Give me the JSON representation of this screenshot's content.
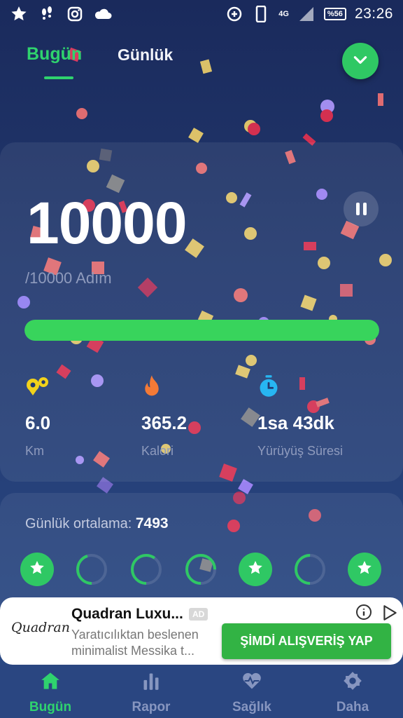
{
  "status_bar": {
    "time": "23:26",
    "network": "4G",
    "battery": "%56",
    "icons": [
      "star-icon",
      "footprints-icon",
      "instagram-icon",
      "cloud-icon",
      "data-saver-icon",
      "phone-icon",
      "signal-icon",
      "battery-icon"
    ]
  },
  "header": {
    "tab_today": "Bugün",
    "tab_daily": "Günlük"
  },
  "steps": {
    "count": "10000",
    "goal": "/10000 Adım",
    "progress_fraction": 1.0
  },
  "stats": [
    {
      "icon": "distance-icon",
      "value": "6.0",
      "label": "Km",
      "color": "#f2d21b"
    },
    {
      "icon": "flame-icon",
      "value": "365.2",
      "label": "Kalori",
      "color": "#f47a36"
    },
    {
      "icon": "stopwatch-icon",
      "value": "1sa 43dk",
      "label": "Yürüyüş Süresi",
      "color": "#27b6f2"
    }
  ],
  "daily_average": {
    "label": "Günlük ortalama:",
    "value": "7493"
  },
  "week_days": [
    {
      "state": "done"
    },
    {
      "state": "partial",
      "fraction": 0.45
    },
    {
      "state": "partial",
      "fraction": 0.6
    },
    {
      "state": "partial",
      "fraction": 0.75
    },
    {
      "state": "done"
    },
    {
      "state": "partial",
      "fraction": 0.5
    },
    {
      "state": "done"
    }
  ],
  "ad": {
    "logo": "Quadran",
    "title": "Quadran Luxu...",
    "badge": "AD",
    "description": "Yaratıcılıktan beslenen minimalist Messika t...",
    "cta": "ŞİMDİ ALIŞVERİŞ YAP"
  },
  "nav": {
    "today": "Bugün",
    "report": "Rapor",
    "health": "Sağlık",
    "more": "Daha"
  },
  "colors": {
    "accent": "#2fd36e",
    "progress": "#38d45c",
    "background": "#22396f"
  }
}
